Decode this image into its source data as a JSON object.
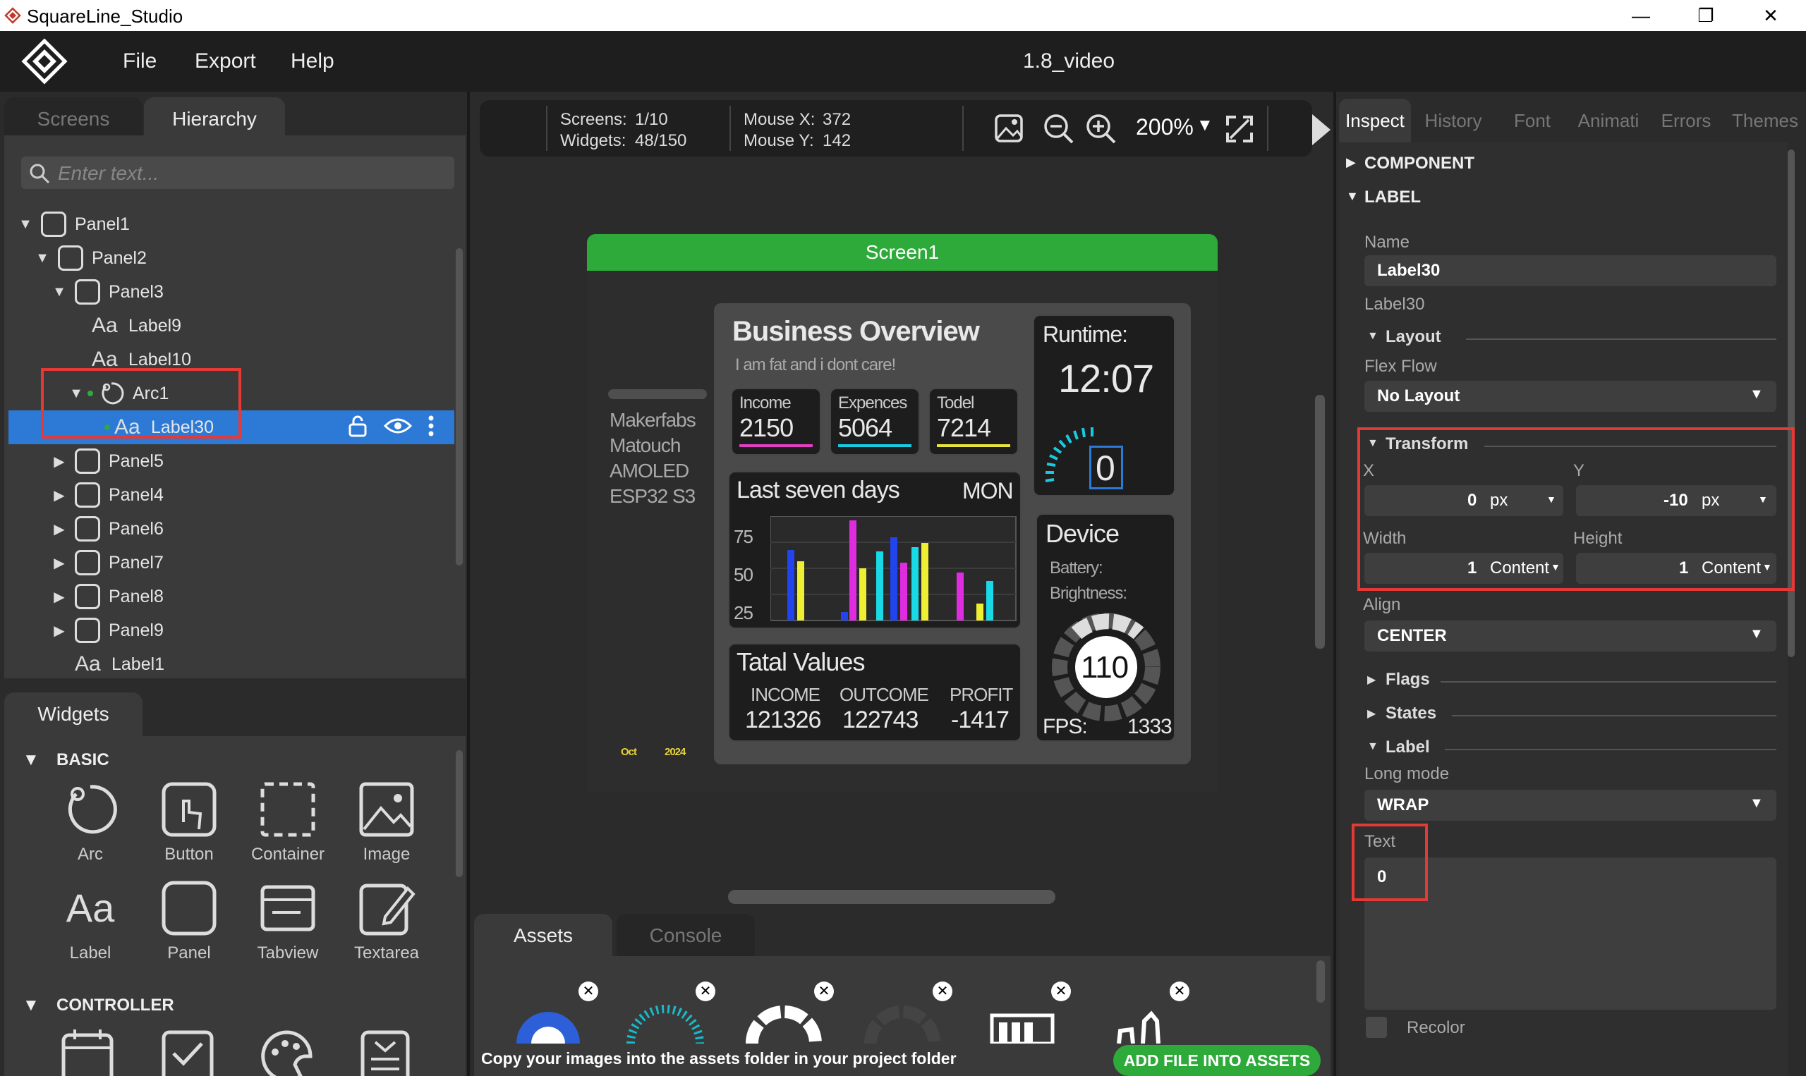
{
  "window": {
    "title": "SquareLine_Studio",
    "minimize": "—",
    "restore": "❐",
    "close": "✕"
  },
  "menu": {
    "items": [
      "File",
      "Export",
      "Help"
    ],
    "project": "1.8_video"
  },
  "left": {
    "tabs": [
      "Screens",
      "Hierarchy"
    ],
    "search_placeholder": "Enter text...",
    "tree": [
      {
        "label": "Panel1",
        "kind": "panel",
        "level": 0,
        "arrow": "▼"
      },
      {
        "label": "Panel2",
        "kind": "panel",
        "level": 1,
        "arrow": "▼"
      },
      {
        "label": "Panel3",
        "kind": "panel",
        "level": 2,
        "arrow": "▼"
      },
      {
        "label": "Label9",
        "kind": "label",
        "level": 3,
        "arrow": ""
      },
      {
        "label": "Label10",
        "kind": "label",
        "level": 3,
        "arrow": ""
      },
      {
        "label": "Arc1",
        "kind": "arc",
        "level": 3,
        "arrow": "▼"
      },
      {
        "label": "Label30",
        "kind": "label",
        "level": 4,
        "arrow": ""
      },
      {
        "label": "Panel5",
        "kind": "panel",
        "level": 2,
        "arrow": "▶"
      },
      {
        "label": "Panel4",
        "kind": "panel",
        "level": 2,
        "arrow": "▶"
      },
      {
        "label": "Panel6",
        "kind": "panel",
        "level": 2,
        "arrow": "▶"
      },
      {
        "label": "Panel7",
        "kind": "panel",
        "level": 2,
        "arrow": "▶"
      },
      {
        "label": "Panel8",
        "kind": "panel",
        "level": 2,
        "arrow": "▶"
      },
      {
        "label": "Panel9",
        "kind": "panel",
        "level": 2,
        "arrow": "▶"
      },
      {
        "label": "Label1",
        "kind": "label",
        "level": 2,
        "arrow": ""
      }
    ],
    "widgets_tab": "Widgets",
    "basic_head": "BASIC",
    "controller_head": "CONTROLLER",
    "widgets": [
      "Arc",
      "Button",
      "Container",
      "Image",
      "Label",
      "Panel",
      "Tabview",
      "Textarea"
    ]
  },
  "toolbar": {
    "screens_label": "Screens:",
    "screens_value": "1/10",
    "widgets_label": "Widgets:",
    "widgets_value": "48/150",
    "mousex_label": "Mouse X:",
    "mousex_value": "372",
    "mousey_label": "Mouse Y:",
    "mousey_value": "142",
    "zoom": "200%"
  },
  "screen": {
    "tab": "Screen1",
    "side_text": [
      "Makerfabs",
      "Matouch",
      "AMOLED",
      "ESP32 S3"
    ],
    "date_month": "Oct",
    "date_year": "2024",
    "business": {
      "title": "Business Overview",
      "subtitle": "I am fat and i dont care!",
      "boxes": [
        {
          "label": "Income",
          "value": "2150",
          "color": "#e040c0"
        },
        {
          "label": "Expences",
          "value": "5064",
          "color": "#19c9e0"
        },
        {
          "label": "Todel",
          "value": "7214",
          "color": "#e6e63a"
        }
      ]
    },
    "runtime": {
      "title": "Runtime:",
      "time": "12:07",
      "value": "0"
    },
    "chart": {
      "title": "Last seven days",
      "day": "MON",
      "ticks": [
        "75",
        "50",
        "25"
      ]
    },
    "totals": {
      "title": "Tatal Values",
      "cols": [
        {
          "label": "INCOME",
          "value": "121326"
        },
        {
          "label": "OUTCOME",
          "value": "122743"
        },
        {
          "label": "PROFIT",
          "value": "-1417"
        }
      ]
    },
    "device": {
      "title": "Device",
      "battery": "Battery:",
      "brightness": "Brightness:",
      "gauge_value": "110",
      "fps_label": "FPS:",
      "fps_value": "1333"
    }
  },
  "assets": {
    "tabs": [
      "Assets",
      "Console"
    ],
    "note": "Copy your images into the assets folder in your project folder",
    "add_button": "ADD FILE INTO ASSETS"
  },
  "inspector": {
    "tabs": [
      "Inspect",
      "History",
      "Font",
      "Animati",
      "Errors",
      "Themes"
    ],
    "component": "COMPONENT",
    "label_head": "LABEL",
    "name_label": "Name",
    "name_value": "Label30",
    "name_hint": "Label30",
    "layout": "Layout",
    "flex_flow_label": "Flex Flow",
    "flex_flow_value": "No Layout",
    "transform": "Transform",
    "x_label": "X",
    "x_value": "0",
    "x_unit": "px",
    "y_label": "Y",
    "y_value": "-10",
    "y_unit": "px",
    "width_label": "Width",
    "width_value": "1",
    "width_unit": "Content",
    "height_label": "Height",
    "height_value": "1",
    "height_unit": "Content",
    "align_label": "Align",
    "align_value": "CENTER",
    "flags": "Flags",
    "states": "States",
    "label_sub": "Label",
    "long_mode_label": "Long mode",
    "long_mode_value": "WRAP",
    "text_label": "Text",
    "text_value": "0",
    "recolor": "Recolor"
  },
  "colors": {
    "selected": "#2d7ad6",
    "green": "#2eaa3b",
    "highlight": "#e53935"
  }
}
